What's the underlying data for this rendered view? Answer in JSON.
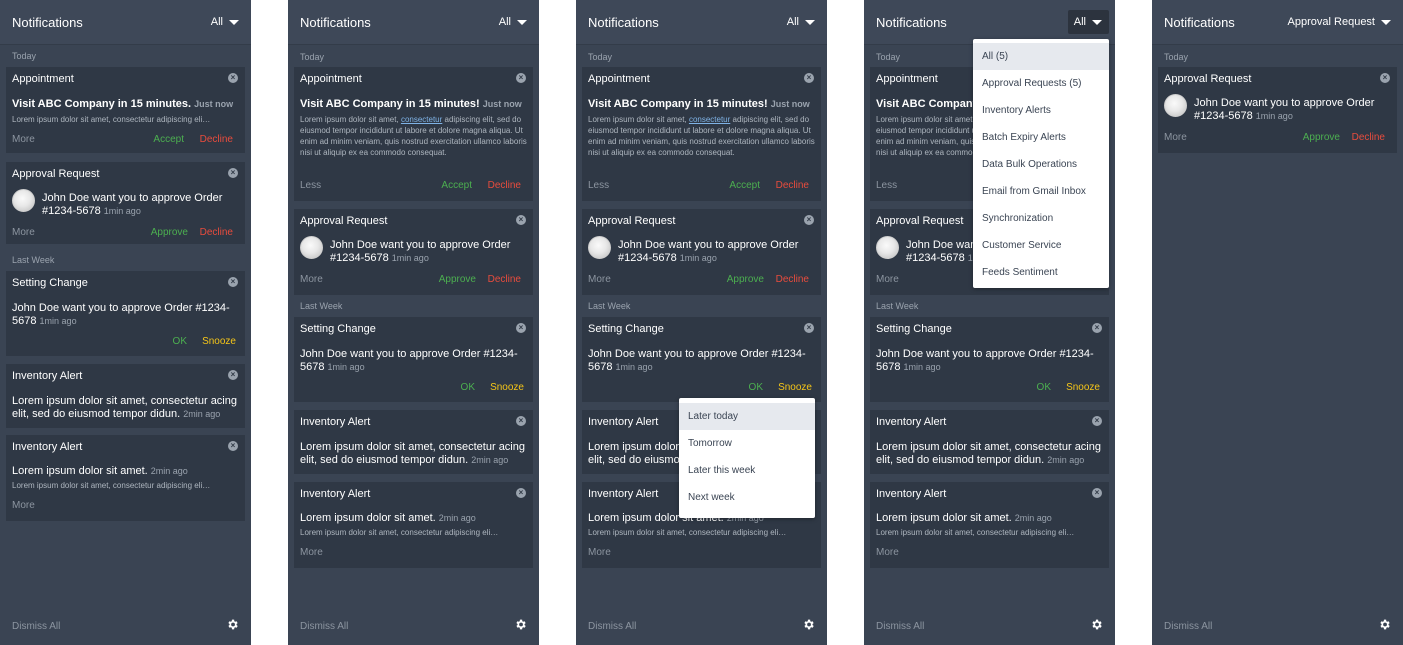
{
  "header": {
    "title": "Notifications",
    "filter_all": "All",
    "filter_approval": "Approval Request"
  },
  "sections": {
    "today": "Today",
    "last_week": "Last Week"
  },
  "appointment": {
    "title": "Appointment",
    "headline_p1": "Visit ABC Company in 15 minutes.",
    "headline": "Visit ABC Company in 15 minutes!",
    "time": "Just now",
    "body_short": "Lorem ipsum dolor sit amet, consectetur adipiscing eli…",
    "body_pre": "Lorem ipsum dolor sit amet, ",
    "body_link": "consectetur",
    "body_post": " adipiscing elit, sed do eiusmod tempor incididunt ut labore et dolore magna aliqua. Ut enim ad minim veniam, quis nostrud exercitation ullamco laboris nisi ut aliquip ex ea commodo consequat.",
    "more": "More",
    "less": "Less",
    "accept": "Accept",
    "decline": "Decline"
  },
  "approval": {
    "title": "Approval Request",
    "text": "John Doe want you to approve Order #1234-5678",
    "time": "1min ago",
    "more": "More",
    "approve": "Approve",
    "decline": "Decline"
  },
  "setting": {
    "title": "Setting Change",
    "text": "John Doe want you to approve Order #1234-5678",
    "time": "1min ago",
    "ok": "OK",
    "snooze": "Snooze"
  },
  "inventory1": {
    "title": "Inventory Alert",
    "text": "Lorem ipsum dolor sit amet, consectetur acing elit, sed do eiusmod tempor didun.",
    "time": "2min ago"
  },
  "inventory2": {
    "title": "Inventory Alert",
    "text": "Lorem ipsum dolor sit amet.",
    "time": "2min ago",
    "sub": "Lorem ipsum dolor sit amet, consectetur adipiscing eli…",
    "more": "More"
  },
  "footer": {
    "dismiss": "Dismiss All"
  },
  "snooze_menu": [
    "Later today",
    "Tomorrow",
    "Later this week",
    "Next week"
  ],
  "filter_menu": [
    "All (5)",
    "Approval Requests (5)",
    "Inventory Alerts",
    "Batch Expiry Alerts",
    "Data Bulk Operations",
    "Email from Gmail Inbox",
    "Synchronization",
    "Customer Service",
    "Feeds Sentiment"
  ],
  "colors": {
    "panel": "#3a4453",
    "card": "#2f3845",
    "accept": "#4caf50",
    "decline": "#e84c3d",
    "snooze": "#f5c518"
  },
  "icons": [
    "close-icon",
    "gear-icon",
    "caret-down-icon",
    "avatar"
  ]
}
